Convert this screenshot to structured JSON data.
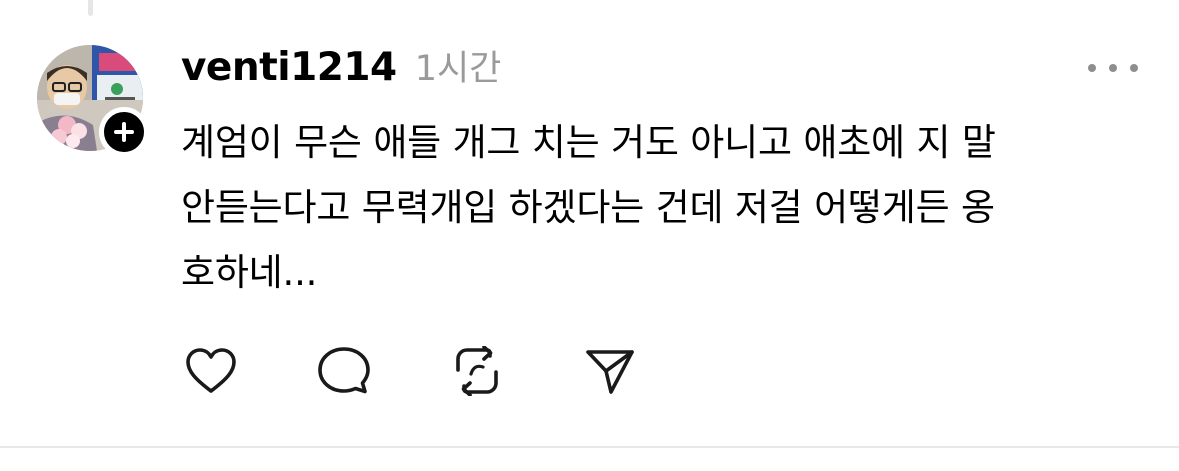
{
  "post": {
    "username": "venti1214",
    "time": "1시간",
    "body_lines": [
      "계엄이 무슨 애들 개그 치는 거도 아니고 애초에 지 말",
      "안듣는다고 무력개입 하겠다는 건데 저걸 어떻게든 옹",
      "호하네..."
    ]
  },
  "icons": {
    "follow": "plus-icon",
    "more": "more-options-icon",
    "like": "heart-icon",
    "comment": "speech-bubble-icon",
    "repost": "repost-icon",
    "share": "send-icon"
  },
  "colors": {
    "text": "#000000",
    "muted": "#9a9a9a",
    "icon": "#1a1a1a",
    "badge": "#000000"
  }
}
